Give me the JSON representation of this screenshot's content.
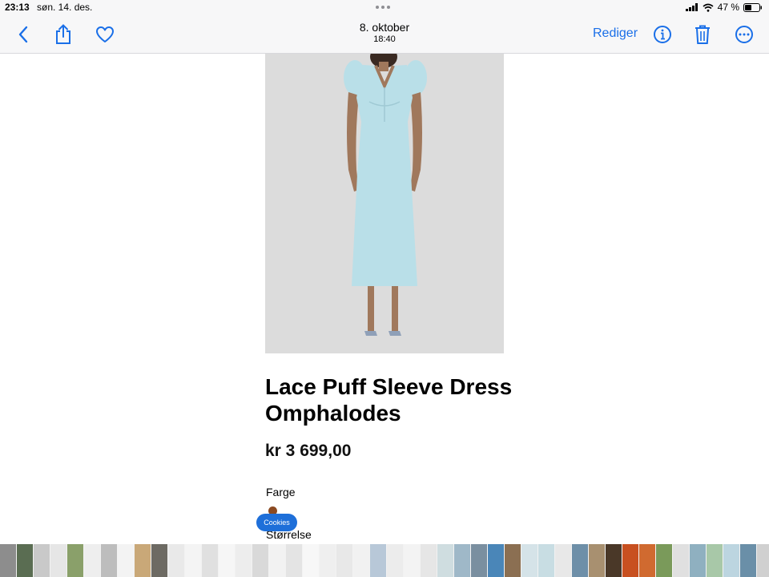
{
  "status_bar": {
    "time": "23:13",
    "date": "søn. 14. des.",
    "battery": "47 %"
  },
  "toolbar": {
    "title_date": "8. oktober",
    "title_time": "18:40",
    "edit_label": "Rediger",
    "icons": [
      "back-chevron-icon",
      "share-icon",
      "heart-icon",
      "info-icon",
      "trash-icon",
      "more-icon"
    ],
    "accent": "#1a6fe8"
  },
  "product": {
    "title": "Lace Puff Sleeve Dress Omphalodes",
    "price": "kr 3 699,00",
    "color_label": "Farge",
    "color_swatch": "#8b4a22",
    "size_label": "Størrelse",
    "dress_color": "#b9dfe8"
  },
  "cookies_label": "Cookies",
  "filmstrip": {
    "colors": [
      "#8d8d8d",
      "#5a6d52",
      "#c9c9c9",
      "#e6e6e6",
      "#8aa06a",
      "#eeeeee",
      "#bdbdbd",
      "#f3f3f3",
      "#c9a878",
      "#6d6a63",
      "#e9e9e9",
      "#f4f4f4",
      "#e0e0e0",
      "#f6f6f6",
      "#ededed",
      "#d9d9d9",
      "#f2f2f2",
      "#e4e4e4",
      "#f7f7f7",
      "#efefef",
      "#e8e8e8",
      "#f1f1f1",
      "#b8c8d8",
      "#ececec",
      "#f3f3f3",
      "#e6e6e6",
      "#cfdde0",
      "#9fb8c8",
      "#7a8fa0",
      "#4a86b8",
      "#8b6f52",
      "#d5e3e8",
      "#c8dde3",
      "#e8e8e8",
      "#6e8fa8",
      "#a89070",
      "#4a3828",
      "#c85020",
      "#d06a30",
      "#7a9a5a",
      "#e0e0e0",
      "#8fb0c0",
      "#a8c8a8",
      "#bcd5e0",
      "#6a8fa8",
      "#d0d0d0",
      "#e8e8e8",
      "#f0f0f0",
      "#c0c0c0",
      "#a0a0a0",
      "#2a3a50",
      "#c0b8a8",
      "#8f7a60",
      "#a89068",
      "#c8b088",
      "#1a1a1a",
      "#e0e0e0",
      "#8a7050",
      "#a08868"
    ]
  }
}
